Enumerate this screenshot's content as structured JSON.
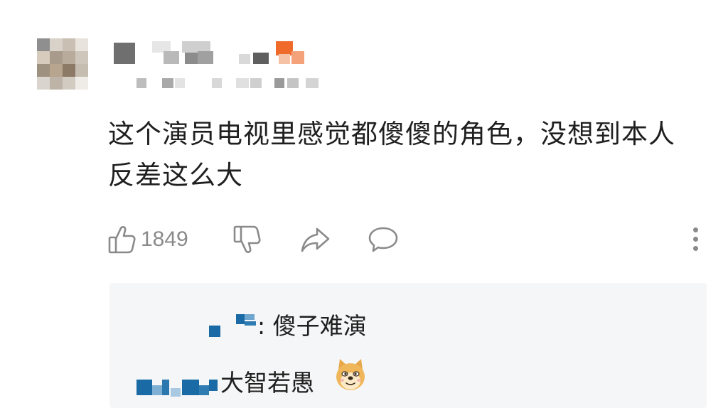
{
  "comment": {
    "text": "这个演员电视里感觉都傻傻的角色，没想到本人反差这么大",
    "like_count": "1849"
  },
  "icons": {
    "like": "thumbs-up-icon",
    "dislike": "thumbs-down-icon",
    "share": "share-arrow-icon",
    "reply": "comment-bubble-icon",
    "more": "more-vertical-icon"
  },
  "replies": [
    {
      "text": ": 傻子难演"
    },
    {
      "text": "大智若愚",
      "emoji": "doge-emoji"
    }
  ],
  "colors": {
    "text": "#1f1f1f",
    "muted": "#8a8a8a",
    "reply_bg": "#f5f6f7",
    "mosaic_blue": "#1a6aa6"
  }
}
